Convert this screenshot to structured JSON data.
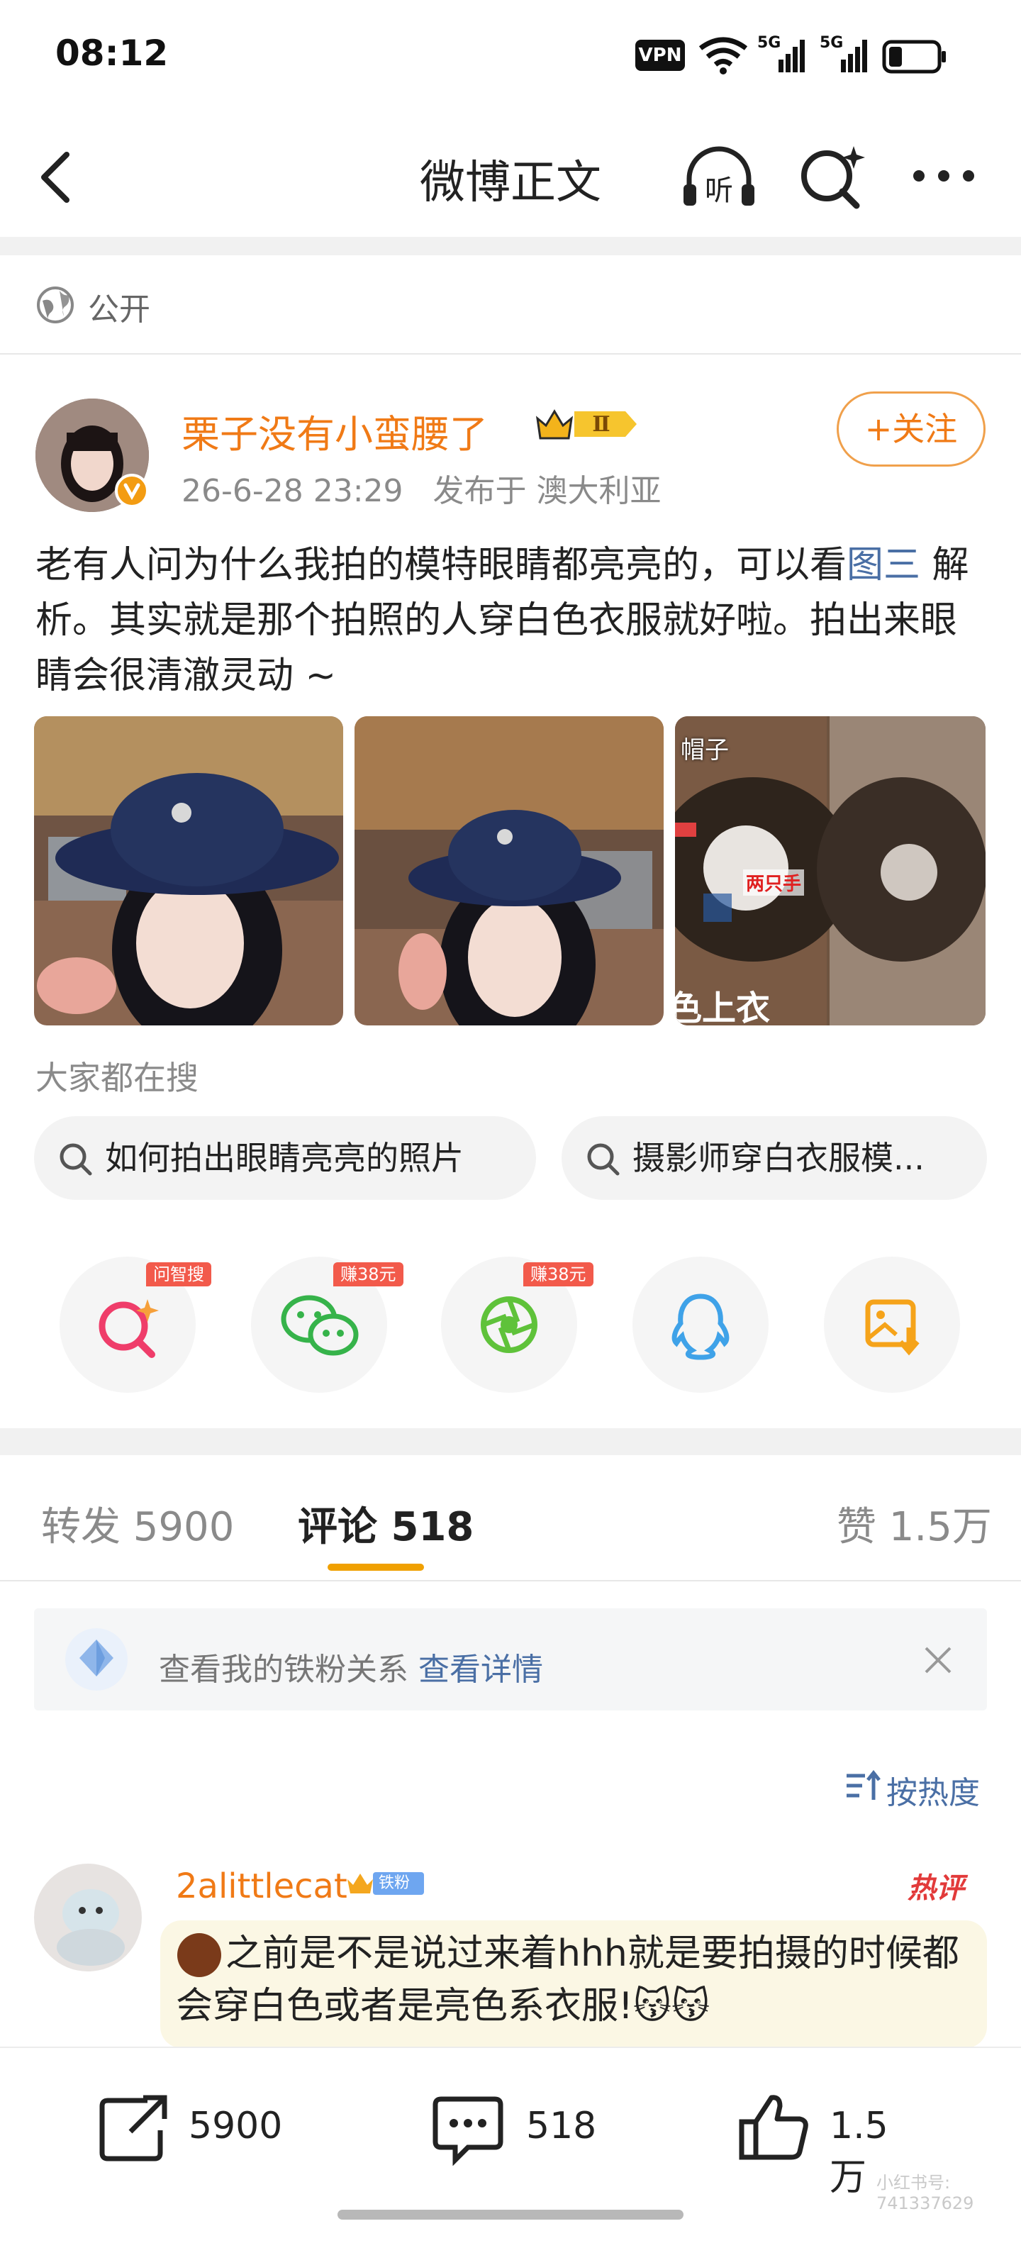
{
  "status_bar": {
    "time": "08:12",
    "vpn": "VPN",
    "net1": "5G",
    "net2": "5G"
  },
  "nav": {
    "title": "微博正文"
  },
  "visibility": {
    "label": "公开"
  },
  "post": {
    "username": "栗子没有小蛮腰了",
    "badge": "Ⅱ",
    "timestamp": "26-6-28 23:29",
    "location": "发布于 澳大利亚",
    "follow_label": "+关注",
    "text_part1": "老有人问为什么我拍的模特眼睛都亮亮的，可以看",
    "text_link": "图三",
    "text_part2": " 解析。其实就是那个拍照的人穿白色衣服就好啦。拍出来眼睛会很清澈灵动 ~",
    "image3_labels": {
      "top": "帽子",
      "middle": "两只手",
      "bottom": "色上衣"
    }
  },
  "search_section": {
    "label": "大家都在搜",
    "chips": [
      "如何拍出眼睛亮亮的照片",
      "摄影师穿白衣服模..."
    ]
  },
  "share_row": {
    "items": [
      {
        "name": "ai-search",
        "tag": "问智搜"
      },
      {
        "name": "wechat",
        "tag": "赚38元"
      },
      {
        "name": "moments",
        "tag": "赚38元"
      },
      {
        "name": "qq",
        "tag": ""
      },
      {
        "name": "save-image",
        "tag": ""
      }
    ]
  },
  "tabs": {
    "repost": "转发 5900",
    "comment": "评论 518",
    "like": "赞 1.5万"
  },
  "fan_banner": {
    "text": "查看我的铁粉关系",
    "link": "查看详情"
  },
  "sort": {
    "label": "按热度"
  },
  "comment": {
    "username": "2alittlecat",
    "fan_badge": "铁粉3",
    "hot_label": "热评",
    "text": "之前是不是说过来着hhh就是要拍摄的时候都会穿白色或者是亮色系衣服!😽😽"
  },
  "bottom_bar": {
    "repost_count": "5900",
    "comment_count": "518",
    "like_count": "1.5万"
  },
  "watermark": "小红书号: 741337629",
  "colors": {
    "accent_orange": "#f07a16",
    "link_blue": "#4a6fa5",
    "tab_underline": "#f0a000"
  }
}
